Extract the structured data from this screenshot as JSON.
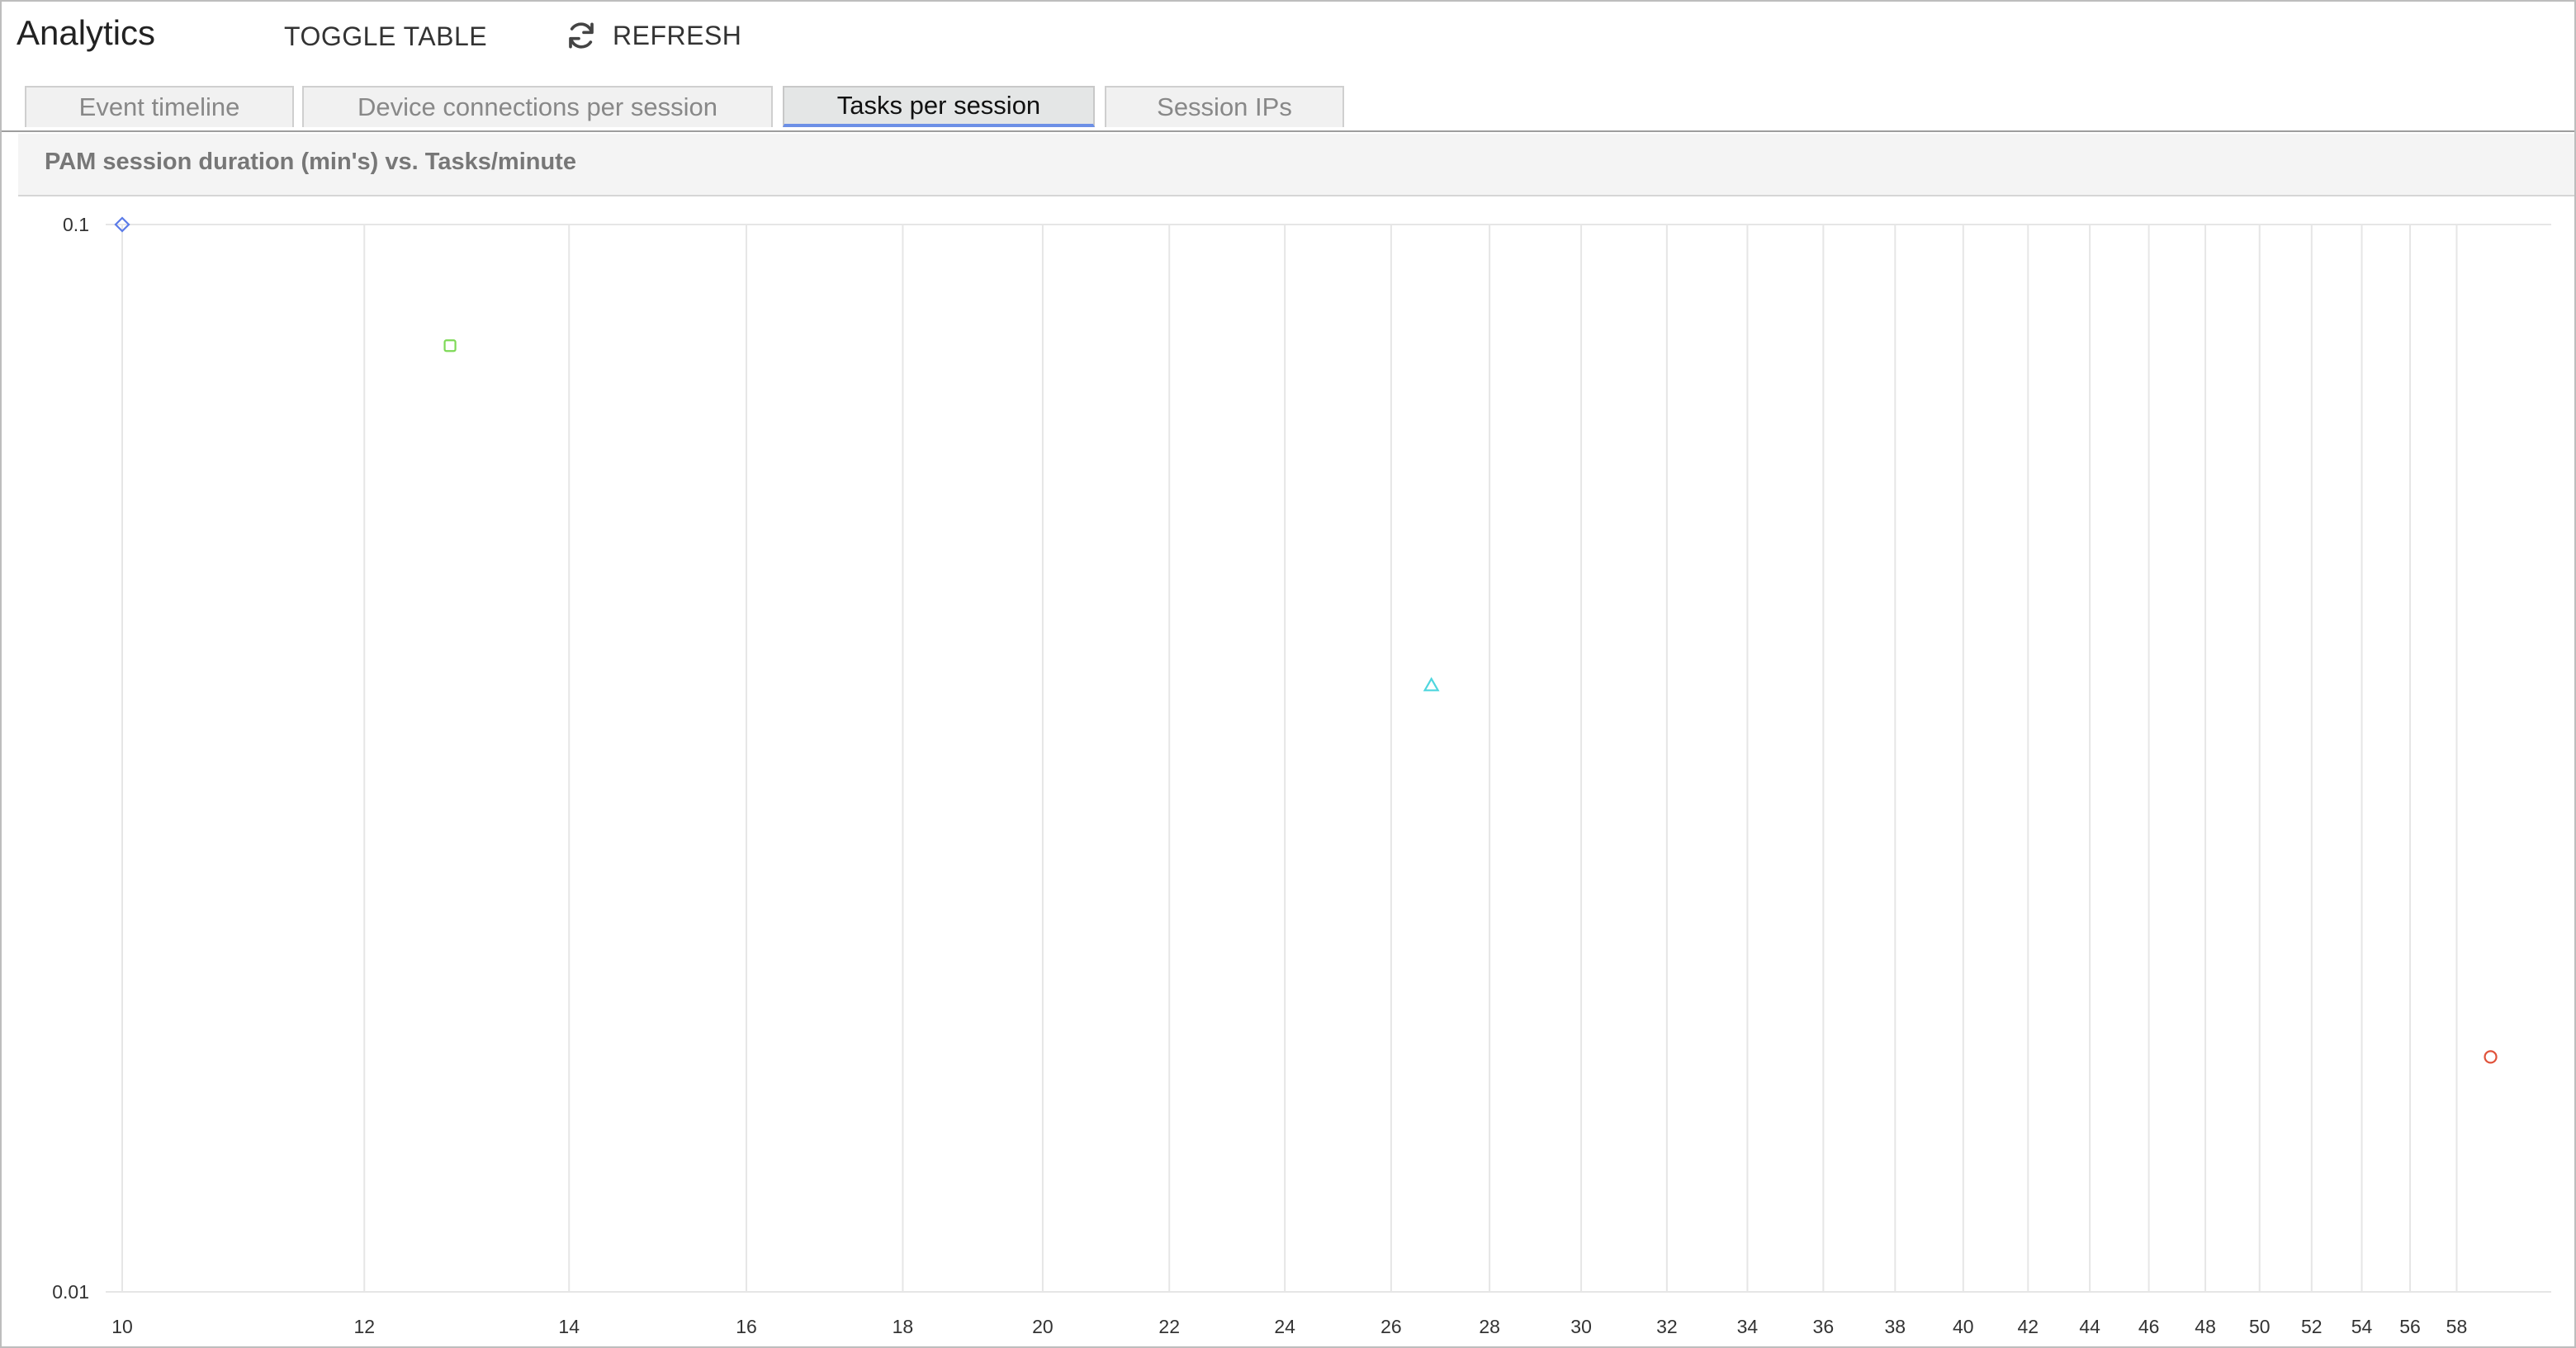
{
  "app": {
    "title": "Analytics"
  },
  "toolbar": {
    "toggle_table_label": "TOGGLE TABLE",
    "refresh_label": "REFRESH",
    "refresh_icon": "refresh-icon"
  },
  "tabs": [
    {
      "label": "Event timeline",
      "active": false
    },
    {
      "label": "Device connections per session",
      "active": false
    },
    {
      "label": "Tasks per session",
      "active": true
    },
    {
      "label": "Session IPs",
      "active": false
    }
  ],
  "colors": {
    "active_tab_underline": "#6c8fe6",
    "grid": "#e6e6e6"
  },
  "chart_data": {
    "type": "scatter",
    "title": "PAM session duration (min's) vs. Tasks/minute",
    "xlabel": "",
    "ylabel": "",
    "xscale": "log",
    "yscale": "log",
    "xlim": [
      10,
      60
    ],
    "ylim": [
      0.01,
      0.1
    ],
    "grid": true,
    "x_ticks": [
      10,
      12,
      14,
      16,
      18,
      20,
      22,
      24,
      26,
      28,
      30,
      32,
      34,
      36,
      38,
      40,
      42,
      44,
      46,
      48,
      50,
      52,
      54,
      56,
      58
    ],
    "y_ticks": [
      0.01,
      0.1
    ],
    "y_tick_labels": [
      "0.01",
      "0.1"
    ],
    "series": [
      {
        "marker": "diamond",
        "color": "#5b7be8",
        "points": [
          {
            "x": 10,
            "y": 0.1
          }
        ]
      },
      {
        "marker": "square",
        "color": "#7ed957",
        "points": [
          {
            "x": 12.8,
            "y": 0.077
          }
        ]
      },
      {
        "marker": "triangle",
        "color": "#4fd6de",
        "points": [
          {
            "x": 26.8,
            "y": 0.037
          }
        ]
      },
      {
        "marker": "circle",
        "color": "#e0523a",
        "points": [
          {
            "x": 59.5,
            "y": 0.0166
          }
        ]
      }
    ]
  }
}
